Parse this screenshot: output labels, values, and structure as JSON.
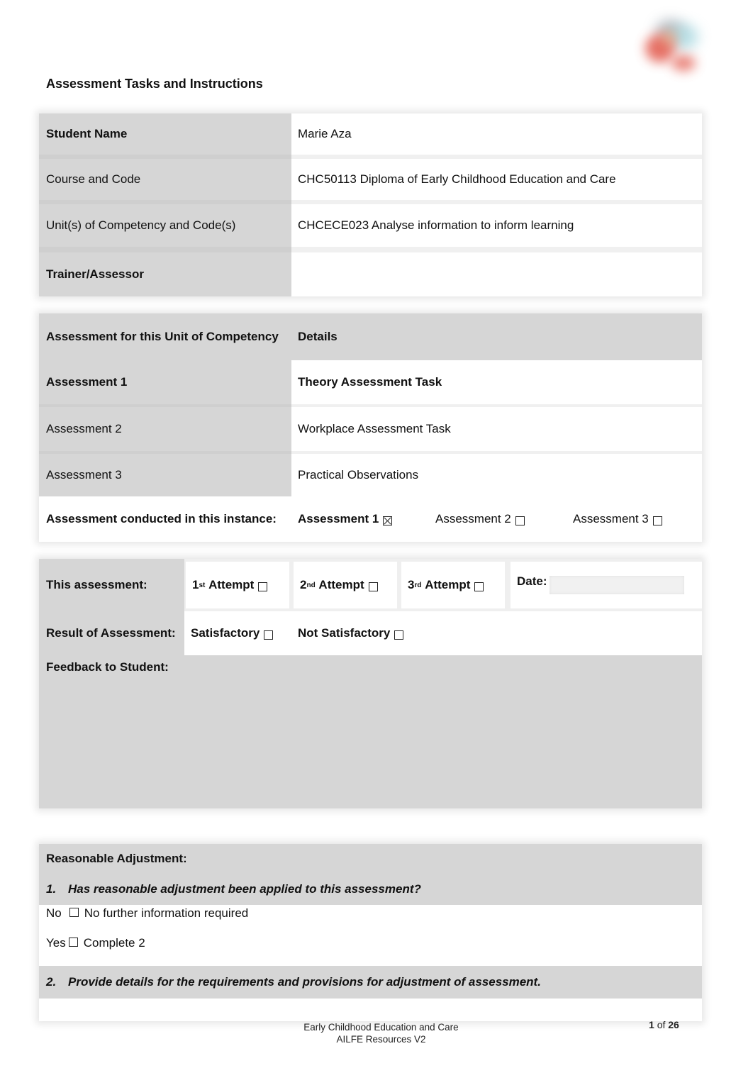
{
  "document": {
    "title": "Assessment Tasks and Instructions",
    "logo": "organisation-logo"
  },
  "student_info": {
    "rows": [
      {
        "label": "Student Name",
        "value": "Marie Aza",
        "label_bold": true
      },
      {
        "label": "Course and Code",
        "value": "CHC50113 Diploma of Early Childhood Education and Care",
        "label_bold": false
      },
      {
        "label": "Unit(s) of Competency and Code(s)",
        "value": "CHCECE023 Analyse information to inform learning",
        "label_bold": false
      },
      {
        "label": "Trainer/Assessor",
        "value": "",
        "label_bold": true
      }
    ]
  },
  "assessment_table": {
    "header_left": "Assessment for this Unit of Competency",
    "header_right": "Details",
    "rows": [
      {
        "label": "Assessment 1",
        "value": "Theory Assessment Task"
      },
      {
        "label": "Assessment 2",
        "value": "Workplace Assessment Task"
      },
      {
        "label": "Assessment 3",
        "value": "Practical Observations"
      }
    ],
    "conducted_label": "Assessment conducted in this instance:",
    "conducted_options": [
      {
        "label": "Assessment 1",
        "checked": true
      },
      {
        "label": "Assessment 2",
        "checked": false
      },
      {
        "label": "Assessment 3",
        "checked": false
      }
    ]
  },
  "result_table": {
    "this_assessment_label": "This assessment:",
    "attempts": [
      {
        "num": "1",
        "suffix": "st",
        "label": "Attempt",
        "checked": false
      },
      {
        "num": "2",
        "suffix": "nd",
        "label": "Attempt",
        "checked": false
      },
      {
        "num": "3",
        "suffix": "rd",
        "label": "Attempt",
        "checked": false
      }
    ],
    "date_label": "Date:",
    "date_value": "",
    "result_label": "Result of Assessment:",
    "satisfactory_label": "Satisfactory",
    "not_satisfactory_label": "Not Satisfactory",
    "feedback_label": "Feedback to Student:",
    "feedback_value": ""
  },
  "reasonable_adjustment": {
    "heading": "Reasonable Adjustment:",
    "q1_number": "1.",
    "q1_text": "Has reasonable adjustment been applied to this assessment?",
    "no_label": "No",
    "no_note": "No further information required",
    "yes_label": "Yes",
    "yes_note": "Complete 2",
    "q2_number": "2.",
    "q2_text": "Provide details for the requirements and provisions for adjustment of assessment."
  },
  "footer": {
    "line1": "Early Childhood Education and Care",
    "line2": "AILFE Resources V2",
    "page_current": "1",
    "page_of": "of",
    "page_total": "26"
  }
}
